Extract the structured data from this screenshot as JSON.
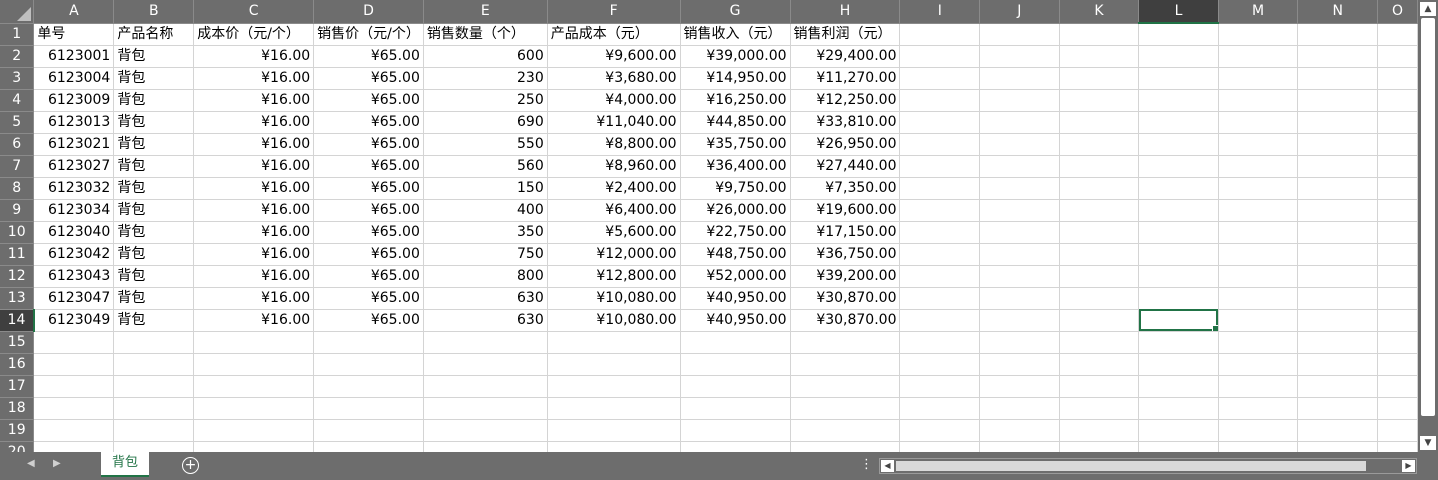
{
  "columns": [
    "A",
    "B",
    "C",
    "D",
    "E",
    "F",
    "G",
    "H",
    "I",
    "J",
    "K",
    "L",
    "M",
    "N",
    "O"
  ],
  "selected_column": "L",
  "selected_row": 14,
  "header_row": [
    "单号",
    "产品名称",
    "成本价（元/个）",
    "销售价（元/个）",
    "销售数量（个）",
    "产品成本（元）",
    "销售收入（元）",
    "销售利润（元）"
  ],
  "rows": [
    [
      "6123001",
      "背包",
      "¥16.00",
      "¥65.00",
      "600",
      "¥9,600.00",
      "¥39,000.00",
      "¥29,400.00"
    ],
    [
      "6123004",
      "背包",
      "¥16.00",
      "¥65.00",
      "230",
      "¥3,680.00",
      "¥14,950.00",
      "¥11,270.00"
    ],
    [
      "6123009",
      "背包",
      "¥16.00",
      "¥65.00",
      "250",
      "¥4,000.00",
      "¥16,250.00",
      "¥12,250.00"
    ],
    [
      "6123013",
      "背包",
      "¥16.00",
      "¥65.00",
      "690",
      "¥11,040.00",
      "¥44,850.00",
      "¥33,810.00"
    ],
    [
      "6123021",
      "背包",
      "¥16.00",
      "¥65.00",
      "550",
      "¥8,800.00",
      "¥35,750.00",
      "¥26,950.00"
    ],
    [
      "6123027",
      "背包",
      "¥16.00",
      "¥65.00",
      "560",
      "¥8,960.00",
      "¥36,400.00",
      "¥27,440.00"
    ],
    [
      "6123032",
      "背包",
      "¥16.00",
      "¥65.00",
      "150",
      "¥2,400.00",
      "¥9,750.00",
      "¥7,350.00"
    ],
    [
      "6123034",
      "背包",
      "¥16.00",
      "¥65.00",
      "400",
      "¥6,400.00",
      "¥26,000.00",
      "¥19,600.00"
    ],
    [
      "6123040",
      "背包",
      "¥16.00",
      "¥65.00",
      "350",
      "¥5,600.00",
      "¥22,750.00",
      "¥17,150.00"
    ],
    [
      "6123042",
      "背包",
      "¥16.00",
      "¥65.00",
      "750",
      "¥12,000.00",
      "¥48,750.00",
      "¥36,750.00"
    ],
    [
      "6123043",
      "背包",
      "¥16.00",
      "¥65.00",
      "800",
      "¥12,800.00",
      "¥52,000.00",
      "¥39,200.00"
    ],
    [
      "6123047",
      "背包",
      "¥16.00",
      "¥65.00",
      "630",
      "¥10,080.00",
      "¥40,950.00",
      "¥30,870.00"
    ],
    [
      "6123049",
      "背包",
      "¥16.00",
      "¥65.00",
      "630",
      "¥10,080.00",
      "¥40,950.00",
      "¥30,870.00"
    ]
  ],
  "total_rows_shown": 20,
  "sheet_tab": "背包",
  "icons": {
    "add_sheet": "+",
    "more": "⋮",
    "nav_prev": "◀",
    "nav_next": "▶",
    "scroll_up": "▲",
    "scroll_down": "▼",
    "scroll_left": "◀",
    "scroll_right": "▶"
  },
  "colors": {
    "accent": "#217346",
    "header_bg": "#6d6d6d",
    "header_sel_bg": "#3f3f3f",
    "grid_line": "#d4d4d4"
  }
}
